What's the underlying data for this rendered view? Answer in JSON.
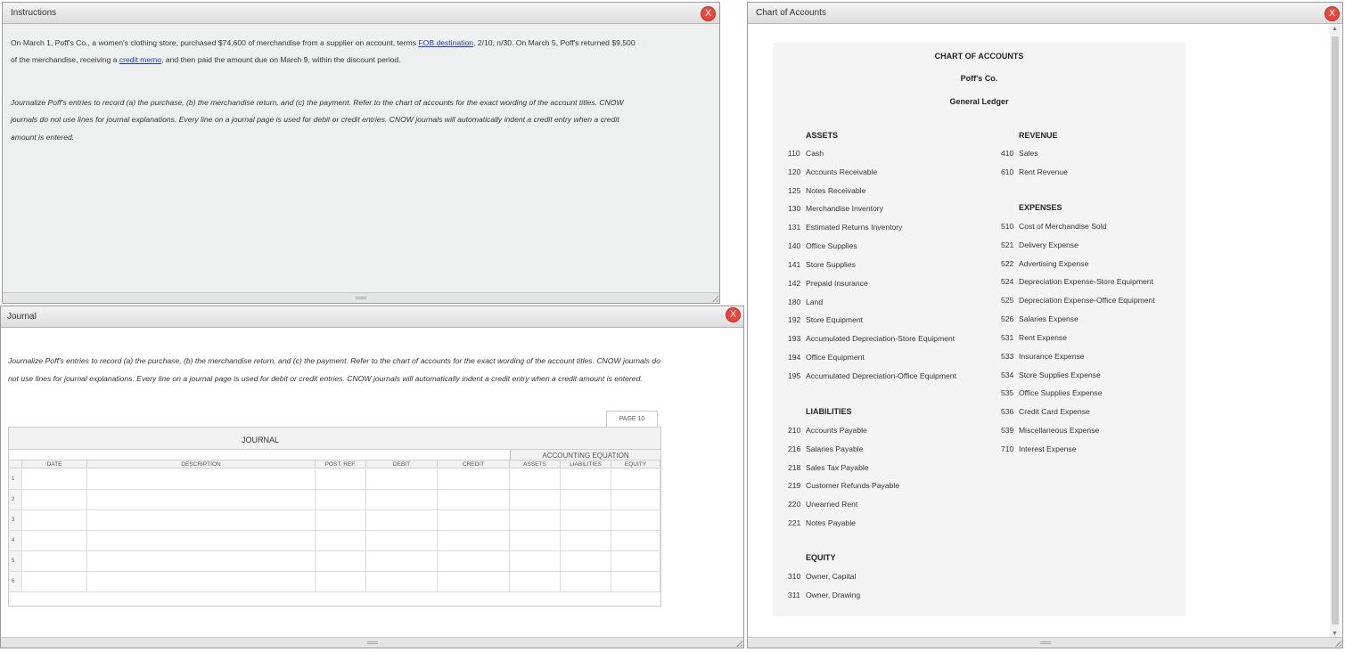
{
  "instructions": {
    "title": "Instructions",
    "close_label": "X",
    "line1_pre": "On March 1, Poff's Co., a women's clothing store, purchased $74,600 of merchandise from a supplier on account, terms ",
    "line1_link": "FOB destination",
    "line1_post": ", 2/10, n/30. On March 5, Poff's returned $9,500",
    "line2_pre": "of the merchandise, receiving a ",
    "line2_link": "credit memo",
    "line2_post": ", and then paid the amount due on March 9, within the discount period.",
    "ital1": "Journalize Poff's entries to record (a) the purchase, (b) the merchandise return, and (c) the payment. Refer to the chart of accounts for the exact wording of the account titles. CNOW",
    "ital2": "journals do not use lines for journal explanations. Every line on a journal page is used for debit or credit entries. CNOW journals will automatically indent a credit entry when a credit",
    "ital3": "amount is entered."
  },
  "journal": {
    "title": "Journal",
    "close_label": "X",
    "ital1": "Journalize Poff's entries to record (a) the purchase, (b) the merchandise return, and (c) the payment. Refer to the chart of accounts for the exact wording of the account titles. CNOW journals do",
    "ital2": "not use lines for journal explanations. Every line on a journal page is used for debit or credit entries. CNOW journals will automatically indent a credit entry when a credit amount is entered.",
    "page_label": "PAGE 10",
    "table_title": "JOURNAL",
    "accounting_equation": "ACCOUNTING EQUATION",
    "headers": {
      "date": "DATE",
      "description": "DESCRIPTION",
      "post_ref": "POST. REF.",
      "debit": "DEBIT",
      "credit": "CREDIT",
      "assets": "ASSETS",
      "liabilities": "LIABILITIES",
      "equity": "EQUITY"
    },
    "rows": [
      "1",
      "2",
      "3",
      "4",
      "5",
      "6"
    ]
  },
  "coa": {
    "title": "Chart of Accounts",
    "close_label": "X",
    "heading": "CHART OF ACCOUNTS",
    "company": "Poff's Co.",
    "ledger": "General Ledger",
    "assets_title": "ASSETS",
    "assets": [
      {
        "num": "110",
        "name": "Cash"
      },
      {
        "num": "120",
        "name": "Accounts Receivable"
      },
      {
        "num": "125",
        "name": "Notes Receivable"
      },
      {
        "num": "130",
        "name": "Merchandise Inventory"
      },
      {
        "num": "131",
        "name": "Estimated Returns Inventory"
      },
      {
        "num": "140",
        "name": "Office Supplies"
      },
      {
        "num": "141",
        "name": "Store Supplies"
      },
      {
        "num": "142",
        "name": "Prepaid Insurance"
      },
      {
        "num": "180",
        "name": "Land"
      },
      {
        "num": "192",
        "name": "Store Equipment"
      },
      {
        "num": "193",
        "name": "Accumulated Depreciation-Store Equipment"
      },
      {
        "num": "194",
        "name": "Office Equipment"
      },
      {
        "num": "195",
        "name": "Accumulated Depreciation-Office Equipment"
      }
    ],
    "liabilities_title": "LIABILITIES",
    "liabilities": [
      {
        "num": "210",
        "name": "Accounts Payable"
      },
      {
        "num": "216",
        "name": "Salaries Payable"
      },
      {
        "num": "218",
        "name": "Sales Tax Payable"
      },
      {
        "num": "219",
        "name": "Customer Refunds Payable"
      },
      {
        "num": "220",
        "name": "Unearned Rent"
      },
      {
        "num": "221",
        "name": "Notes Payable"
      }
    ],
    "equity_title": "EQUITY",
    "equity": [
      {
        "num": "310",
        "name": "Owner, Capital"
      },
      {
        "num": "311",
        "name": "Owner, Drawing"
      }
    ],
    "revenue_title": "REVENUE",
    "revenue": [
      {
        "num": "410",
        "name": "Sales"
      },
      {
        "num": "610",
        "name": "Rent Revenue"
      }
    ],
    "expenses_title": "EXPENSES",
    "expenses": [
      {
        "num": "510",
        "name": "Cost of Merchandise Sold"
      },
      {
        "num": "521",
        "name": "Delivery Expense"
      },
      {
        "num": "522",
        "name": "Advertising Expense"
      },
      {
        "num": "524",
        "name": "Depreciation Expense-Store Equipment"
      },
      {
        "num": "525",
        "name": "Depreciation Expense-Office Equipment"
      },
      {
        "num": "526",
        "name": "Salaries Expense"
      },
      {
        "num": "531",
        "name": "Rent Expense"
      },
      {
        "num": "533",
        "name": "Insurance Expense"
      },
      {
        "num": "534",
        "name": "Store Supplies Expense"
      },
      {
        "num": "535",
        "name": "Office Supplies Expense"
      },
      {
        "num": "536",
        "name": "Credit Card Expense"
      },
      {
        "num": "539",
        "name": "Miscellaneous Expense"
      },
      {
        "num": "710",
        "name": "Interest Expense"
      }
    ]
  }
}
